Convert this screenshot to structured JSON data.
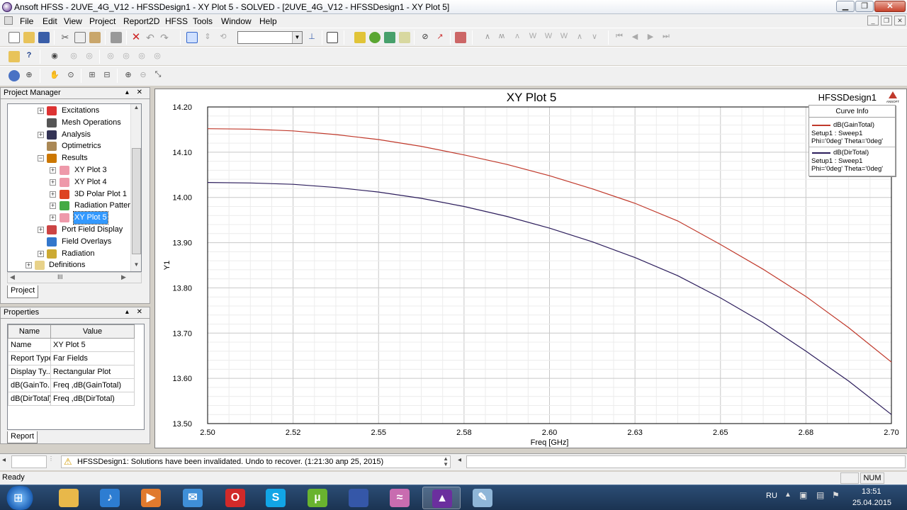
{
  "window": {
    "title": "Ansoft HFSS - 2UVE_4G_V12 - HFSSDesign1 - XY Plot 5 - SOLVED - [2UVE_4G_V12 - HFSSDesign1 - XY Plot 5]"
  },
  "menu": [
    "File",
    "Edit",
    "View",
    "Project",
    "Report2D",
    "HFSS",
    "Tools",
    "Window",
    "Help"
  ],
  "project_manager": {
    "title": "Project Manager",
    "tree": [
      {
        "label": "Excitations",
        "icon": "excitations-icon",
        "expander": "+"
      },
      {
        "label": "Mesh Operations",
        "icon": "mesh-icon",
        "expander": ""
      },
      {
        "label": "Analysis",
        "icon": "analysis-icon",
        "expander": "+"
      },
      {
        "label": "Optimetrics",
        "icon": "optimetrics-icon",
        "expander": ""
      },
      {
        "label": "Results",
        "icon": "results-icon",
        "expander": "−"
      },
      {
        "label": "XY Plot 3",
        "icon": "xy-plot-icon",
        "expander": "+"
      },
      {
        "label": "XY Plot 4",
        "icon": "xy-plot-icon",
        "expander": "+"
      },
      {
        "label": "3D Polar Plot 1",
        "icon": "polar-plot-icon",
        "expander": "+"
      },
      {
        "label": "Radiation Pattern",
        "icon": "radiation-pattern-icon",
        "expander": "+"
      },
      {
        "label": "XY Plot 5",
        "icon": "xy-plot-icon",
        "expander": "+",
        "selected": true
      },
      {
        "label": "Port Field Display",
        "icon": "port-field-icon",
        "expander": "+"
      },
      {
        "label": "Field Overlays",
        "icon": "field-overlay-icon",
        "expander": ""
      },
      {
        "label": "Radiation",
        "icon": "radiation-icon",
        "expander": "+"
      },
      {
        "label": "Definitions",
        "icon": "folder-icon",
        "expander": "+"
      }
    ],
    "tab": "Project",
    "scroll_mark": "III"
  },
  "properties": {
    "title": "Properties",
    "columns": [
      "Name",
      "Value"
    ],
    "rows": [
      [
        "Name",
        "XY Plot 5"
      ],
      [
        "Report Type",
        "Far Fields"
      ],
      [
        "Display Ty...",
        "Rectangular Plot"
      ],
      [
        "dB(GainTo...",
        "Freq ,dB(GainTotal)"
      ],
      [
        "dB(DirTotal)",
        "Freq ,dB(DirTotal)"
      ]
    ],
    "tab": "Report"
  },
  "plot": {
    "design_name": "HFSSDesign1",
    "logo_text": "ANSOFT",
    "legend_title": "Curve Info",
    "legend": [
      {
        "name": "dB(GainTotal)",
        "line1": "Setup1 : Sweep1",
        "line2": "Phi='0deg' Theta='0deg'",
        "color": "#c0392b"
      },
      {
        "name": "dB(DirTotal)",
        "line1": "Setup1 : Sweep1",
        "line2": "Phi='0deg' Theta='0deg'",
        "color": "#2c1d5c"
      }
    ]
  },
  "chart_data": {
    "type": "line",
    "title": "XY Plot 5",
    "xlabel": "Freq [GHz]",
    "ylabel": "Y1",
    "xlim": [
      2.5,
      2.7
    ],
    "ylim": [
      13.5,
      14.2
    ],
    "xticks": [
      "2.50",
      "2.52",
      "2.55",
      "2.58",
      "2.60",
      "2.63",
      "2.65",
      "2.68",
      "2.70"
    ],
    "yticks": [
      "13.50",
      "13.60",
      "13.70",
      "13.80",
      "13.90",
      "14.00",
      "14.10",
      "14.20"
    ],
    "grid": true,
    "legend_position": "top-right",
    "x": [
      2.5,
      2.5125,
      2.525,
      2.5375,
      2.55,
      2.5625,
      2.575,
      2.5875,
      2.6,
      2.6125,
      2.625,
      2.6375,
      2.65,
      2.6625,
      2.675,
      2.6875,
      2.7
    ],
    "series": [
      {
        "name": "dB(GainTotal)",
        "color": "#c0392b",
        "values": [
          14.152,
          14.151,
          14.147,
          14.139,
          14.128,
          14.113,
          14.094,
          14.073,
          14.048,
          14.019,
          13.987,
          13.948,
          13.896,
          13.841,
          13.781,
          13.712,
          13.636
        ]
      },
      {
        "name": "dB(DirTotal)",
        "color": "#2c1d5c",
        "values": [
          14.033,
          14.032,
          14.029,
          14.022,
          14.012,
          13.998,
          13.98,
          13.958,
          13.932,
          13.902,
          13.867,
          13.827,
          13.778,
          13.723,
          13.66,
          13.594,
          13.52
        ]
      }
    ]
  },
  "status": {
    "message": "HFSSDesign1: Solutions have been invalidated. Undo to recover. (1:21:30  апр 25, 2015)",
    "ready": "Ready",
    "num": "NUM"
  },
  "taskbar": {
    "lang": "RU",
    "time": "13:51",
    "date": "25.04.2015",
    "apps": [
      {
        "name": "explorer-icon",
        "color": "#e8b84a",
        "glyph": ""
      },
      {
        "name": "media-player-icon",
        "color": "#2d7dd2",
        "glyph": "♪"
      },
      {
        "name": "player-icon",
        "color": "#e07a2e",
        "glyph": "▶"
      },
      {
        "name": "mail-icon",
        "color": "#3f8fd8",
        "glyph": "✉"
      },
      {
        "name": "opera-icon",
        "color": "#d12a2a",
        "glyph": "O"
      },
      {
        "name": "skype-icon",
        "color": "#12a5e6",
        "glyph": "S"
      },
      {
        "name": "utorrent-icon",
        "color": "#69b32f",
        "glyph": "µ"
      },
      {
        "name": "save-disk-icon",
        "color": "#3557a8",
        "glyph": ""
      },
      {
        "name": "designer-icon",
        "color": "#c86cb0",
        "glyph": "≈"
      },
      {
        "name": "hfss-icon",
        "color": "#6b2f9e",
        "glyph": "▲"
      },
      {
        "name": "paint-icon",
        "color": "#8fb6d8",
        "glyph": "✎"
      }
    ]
  }
}
